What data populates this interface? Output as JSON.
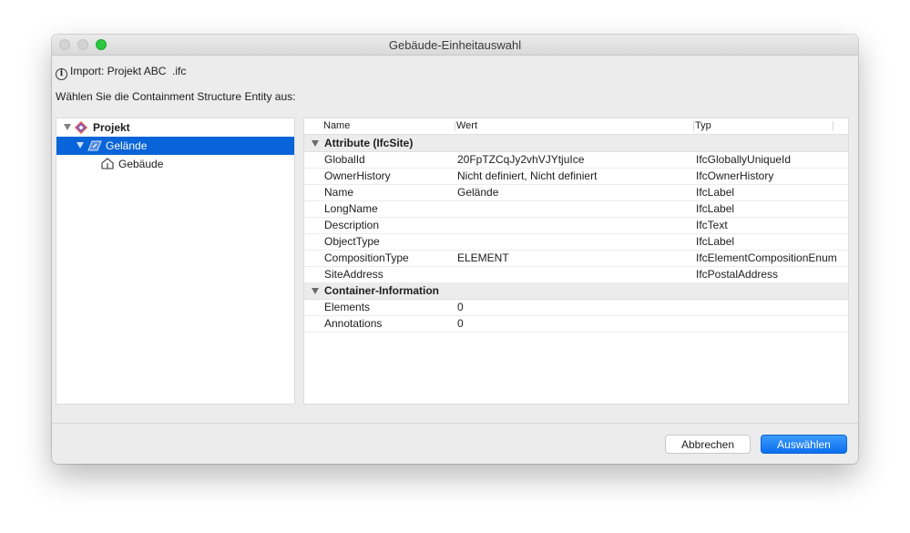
{
  "window": {
    "title": "Gebäude-Einheitauswahl"
  },
  "import_text": "Import: Projekt ABC  .ifc",
  "prompt_text": "Wählen Sie die Containment Structure Entity aus:",
  "tree": {
    "items": [
      {
        "label": "Projekt",
        "icon": "ifc-project-icon",
        "selected": false,
        "expanded": true
      },
      {
        "label": "Gelände",
        "icon": "ifc-site-icon",
        "selected": true,
        "expanded": true
      },
      {
        "label": "Gebäude",
        "icon": "building-icon",
        "selected": false
      }
    ]
  },
  "table": {
    "columns": [
      "Name",
      "Wert",
      "Typ"
    ],
    "groups": [
      {
        "title": "Attribute (IfcSite)",
        "rows": [
          [
            "GlobalId",
            "20FpTZCqJy2vhVJYtjuIce",
            "IfcGloballyUniqueId"
          ],
          [
            "OwnerHistory",
            "Nicht definiert, Nicht definiert",
            "IfcOwnerHistory"
          ],
          [
            "Name",
            "Gelände",
            "IfcLabel"
          ],
          [
            "LongName",
            "",
            "IfcLabel"
          ],
          [
            "Description",
            "",
            "IfcText"
          ],
          [
            "ObjectType",
            "",
            "IfcLabel"
          ],
          [
            "CompositionType",
            "ELEMENT",
            "IfcElementCompositionEnum"
          ],
          [
            "SiteAddress",
            "",
            "IfcPostalAddress"
          ]
        ]
      },
      {
        "title": "Container-Information",
        "rows": [
          [
            "Elements",
            "0",
            ""
          ],
          [
            "Annotations",
            "0",
            ""
          ]
        ]
      }
    ]
  },
  "buttons": {
    "cancel": "Abbrechen",
    "ok": "Auswählen"
  },
  "colors": {
    "selection": "#0864d8",
    "primary_button": "#0a6ff0"
  }
}
